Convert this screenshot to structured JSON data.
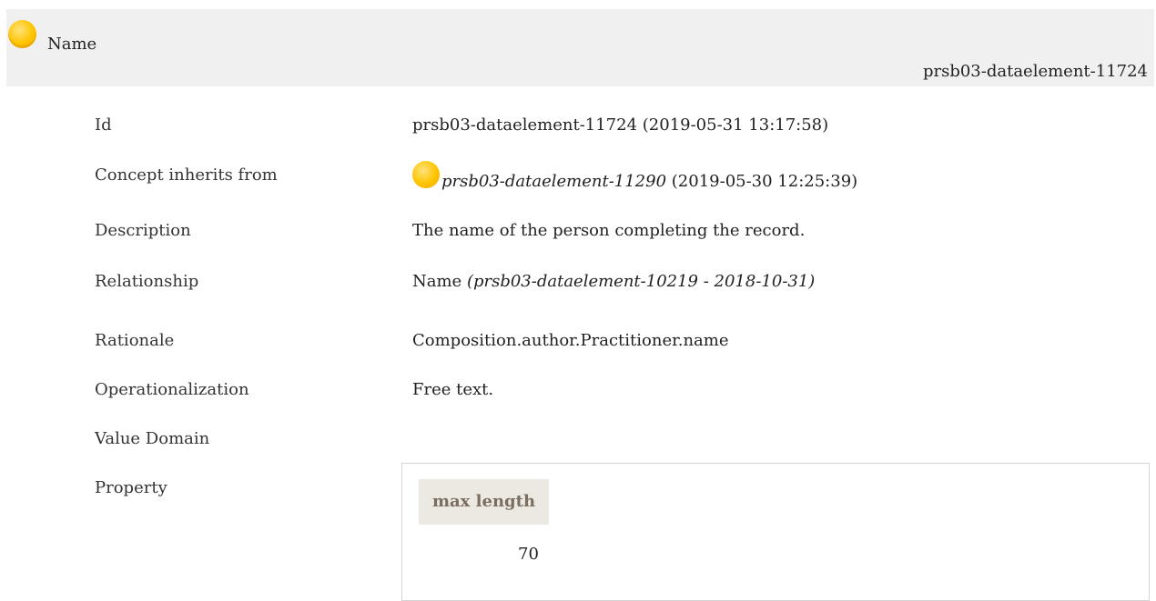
{
  "header": {
    "title": "Name",
    "id": "prsb03-dataelement-11724",
    "status_icon": "status-orange-icon"
  },
  "rows": {
    "id": {
      "label": "Id",
      "value": "prsb03-dataelement-11724 (2019-05-31 13:17:58)"
    },
    "inherits": {
      "label": "Concept inherits from",
      "link": "prsb03-dataelement-11290",
      "date": "(2019-05-30 12:25:39)"
    },
    "description": {
      "label": "Description",
      "value": "The name of the person completing the record."
    },
    "relationship": {
      "label": "Relationship",
      "name": "Name",
      "ref": "(prsb03-dataelement-10219 - 2018-10-31)"
    },
    "rationale": {
      "label": "Rationale",
      "value": "Composition.author.Practitioner.name"
    },
    "operationalization": {
      "label": "Operationalization",
      "value": "Free text."
    },
    "value_domain": {
      "label": "Value Domain"
    },
    "property": {
      "label": "Property",
      "column_header": "max length",
      "value": "70"
    }
  },
  "colors": {
    "header_bg": "#f0f0f0",
    "status_dot": "#ffc400",
    "property_head_bg": "#ece8e2",
    "property_head_text": "#7a6e60"
  }
}
